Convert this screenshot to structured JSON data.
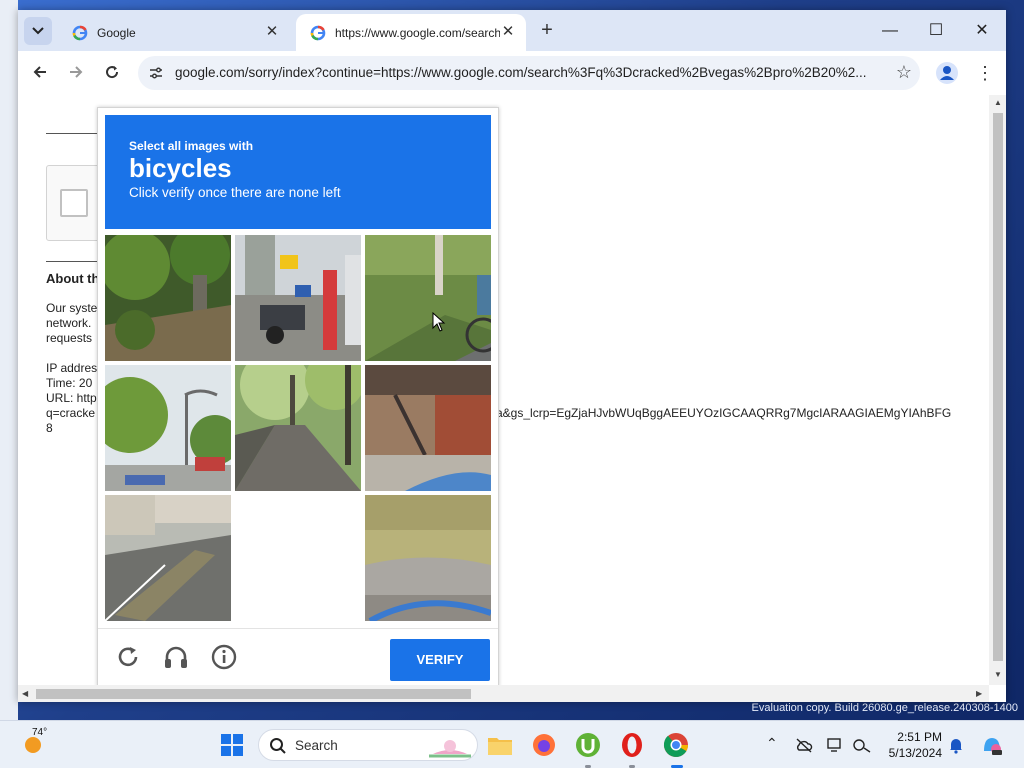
{
  "browser": {
    "tabs": [
      {
        "title": "Google"
      },
      {
        "title": "https://www.google.com/search?q"
      }
    ],
    "new_tab": "+",
    "window_controls": {
      "minimize": "—",
      "maximize": "☐",
      "close": "✕"
    },
    "address": "google.com/sorry/index?continue=https://www.google.com/search%3Fq%3Dcracked%2Bvegas%2Bpro%2B20%2..."
  },
  "sorry_page": {
    "about_heading": "About th",
    "paragraph_lines": [
      "Our syste",
      "network.",
      "requests"
    ],
    "info_lines": [
      "IP addres",
      "Time: 20",
      "URL: http",
      "q=cracke",
      "8"
    ],
    "long_url_tail": "a&gs_lcrp=EgZjaHJvbWUqBggAEEUYOzIGCAAQRRg7MgcIARAAGIAEMgYIAhBFG"
  },
  "captcha": {
    "select_prompt": "Select all images with",
    "target_object": "bicycles",
    "instruction": "Click verify once there are none left",
    "verify_label": "VERIFY",
    "tiles": [
      {
        "description": "forest-path"
      },
      {
        "description": "street-signs"
      },
      {
        "description": "grass-cyclist"
      },
      {
        "description": "street-lamp"
      },
      {
        "description": "tree-lined-path"
      },
      {
        "description": "building-stairs"
      },
      {
        "description": "street-crossing"
      },
      {
        "description": "empty"
      },
      {
        "description": "grass-bike-wheel"
      }
    ]
  },
  "desktop": {
    "watermark": "Evaluation copy. Build 26080.ge_release.240308-1400"
  },
  "taskbar": {
    "temperature": "74°",
    "search_placeholder": "Search",
    "time": "2:51 PM",
    "date": "5/13/2024"
  },
  "colors": {
    "accent": "#1a73e8",
    "tab_strip": "#dde6f6",
    "taskbar": "#eaf0f8"
  }
}
